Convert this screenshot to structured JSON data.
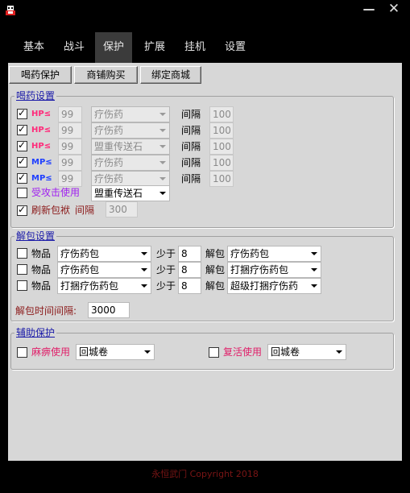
{
  "nav": {
    "tabs": [
      {
        "label": "基本"
      },
      {
        "label": "战斗"
      },
      {
        "label": "保护"
      },
      {
        "label": "扩展"
      },
      {
        "label": "挂机"
      },
      {
        "label": "设置"
      }
    ],
    "active": "保护"
  },
  "subtabs": [
    {
      "label": "喝药保护"
    },
    {
      "label": "商铺购买"
    },
    {
      "label": "绑定商城"
    }
  ],
  "potion": {
    "title": "喝药设置",
    "interval_label": "间隔",
    "rows": [
      {
        "checked": true,
        "label": "HP≤",
        "threshold": "99",
        "item": "疗伤药",
        "interval": "100",
        "type": "hp"
      },
      {
        "checked": true,
        "label": "HP≤",
        "threshold": "99",
        "item": "疗伤药",
        "interval": "100",
        "type": "hp"
      },
      {
        "checked": true,
        "label": "HP≤",
        "threshold": "99",
        "item": "盟重传送石",
        "interval": "100",
        "type": "hp"
      },
      {
        "checked": true,
        "label": "MP≤",
        "threshold": "99",
        "item": "疗伤药",
        "interval": "100",
        "type": "mp"
      },
      {
        "checked": true,
        "label": "MP≤",
        "threshold": "99",
        "item": "疗伤药",
        "interval": "100",
        "type": "mp"
      }
    ],
    "attacked": {
      "checked": false,
      "label": "受攻击使用",
      "item": "盟重传送石"
    },
    "refresh": {
      "checked": true,
      "label": "刷新包袱",
      "interval_label": "间隔",
      "value": "300"
    }
  },
  "unpack": {
    "title": "解包设置",
    "item_label": "物品",
    "less_label": "少于",
    "unpack_label": "解包",
    "rows": [
      {
        "checked": false,
        "item": "疗伤药包",
        "count": "8",
        "target": "疗伤药包"
      },
      {
        "checked": false,
        "item": "疗伤药包",
        "count": "8",
        "target": "打捆疗伤药包"
      },
      {
        "checked": false,
        "item": "打捆疗伤药包",
        "count": "8",
        "target": "超级打捆疗伤药"
      }
    ],
    "interval_label": "解包时间间隔:",
    "interval_value": "3000"
  },
  "assist": {
    "title": "辅助保护",
    "paralyze": {
      "checked": false,
      "label": "麻痹使用",
      "item": "回城卷"
    },
    "revive": {
      "checked": false,
      "label": "复活使用",
      "item": "回城卷"
    }
  },
  "footer": {
    "text": "永恒武门   Copyright 2018"
  },
  "colors": {
    "hp": "#ff2a7a",
    "mp": "#2040ff",
    "attacked": "#a020f0",
    "paralyze": "#e0206a",
    "revive": "#e0206a",
    "group_title": "#1a1aa8"
  }
}
